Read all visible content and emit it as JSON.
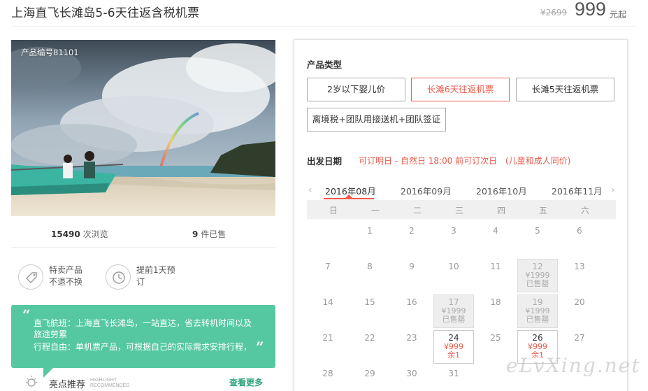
{
  "header": {
    "title": "上海直飞长滩岛5-6天往返含税机票",
    "original_price": "¥2699",
    "price": "999",
    "price_unit": "元起"
  },
  "product": {
    "product_no": "产品编号81101",
    "views_count": "15490",
    "views_label": "次浏览",
    "sold_count": "9",
    "sold_label": "件已售"
  },
  "features": [
    {
      "icon": "tag-icon",
      "line1": "特卖产品",
      "line2": "不退不换"
    },
    {
      "icon": "clock-icon",
      "line1": "提前1天预",
      "line2": "订"
    }
  ],
  "promo": {
    "open_quote": "“",
    "close_quote": "”",
    "line1": "直飞航班：上海直飞长滩岛，一站直达，省去转机时间以及旅途劳累",
    "line2": "行程自由：单机票产品，可根据自己的实际需求安排行程，"
  },
  "highlight": {
    "title": "亮点推荐",
    "en_line1": "HIGHLIGHT",
    "en_line2": "RECOMMENDED",
    "more": "查看更多"
  },
  "product_type": {
    "label": "产品类型",
    "options": [
      {
        "label": "2岁以下婴儿价",
        "selected": false
      },
      {
        "label": "长滩6天往返机票",
        "selected": true
      },
      {
        "label": "长滩5天往返机票",
        "selected": false
      },
      {
        "label": "离境税+团队用接送机+团队签证",
        "selected": false
      }
    ]
  },
  "departure": {
    "label": "出发日期",
    "note": "可订明日 - 自然日 18:00 前可订次日",
    "note2": "(儿童和成人同价)",
    "prev_arrow": "‹",
    "next_arrow": "›",
    "months": [
      "2016年08月",
      "2016年09月",
      "2016年10月",
      "2016年11月"
    ],
    "active_month": 0,
    "weekdays": [
      "日",
      "一",
      "二",
      "三",
      "四",
      "五",
      "六"
    ],
    "plain_days": [
      [
        "",
        "1",
        "2",
        "3",
        "4",
        "5",
        "6"
      ],
      [
        "7",
        "8",
        "9",
        "10",
        "11",
        "",
        "13"
      ],
      [
        "14",
        "15",
        "16",
        "",
        "18",
        "",
        "20"
      ],
      [
        "21",
        "22",
        "23",
        "",
        "25",
        "",
        "27"
      ],
      [
        "28",
        "29",
        "30",
        "31",
        "",
        "",
        ""
      ]
    ],
    "priced_days": [
      {
        "day": "12",
        "price": "¥1999",
        "status": "已售罄",
        "state": "sold"
      },
      {
        "day": "17",
        "price": "¥1999",
        "status": "已售罄",
        "state": "sold"
      },
      {
        "day": "19",
        "price": "¥1999",
        "status": "已售罄",
        "state": "sold"
      },
      {
        "day": "24",
        "price": "¥999",
        "status": "余1",
        "state": "avail"
      },
      {
        "day": "26",
        "price": "¥999",
        "status": "余1",
        "state": "avail"
      }
    ]
  },
  "watermark": "eLvXing.net",
  "colors": {
    "accent_red": "#f05a4a",
    "promo_green": "#55c8a1",
    "link_green": "#2fa57c"
  }
}
